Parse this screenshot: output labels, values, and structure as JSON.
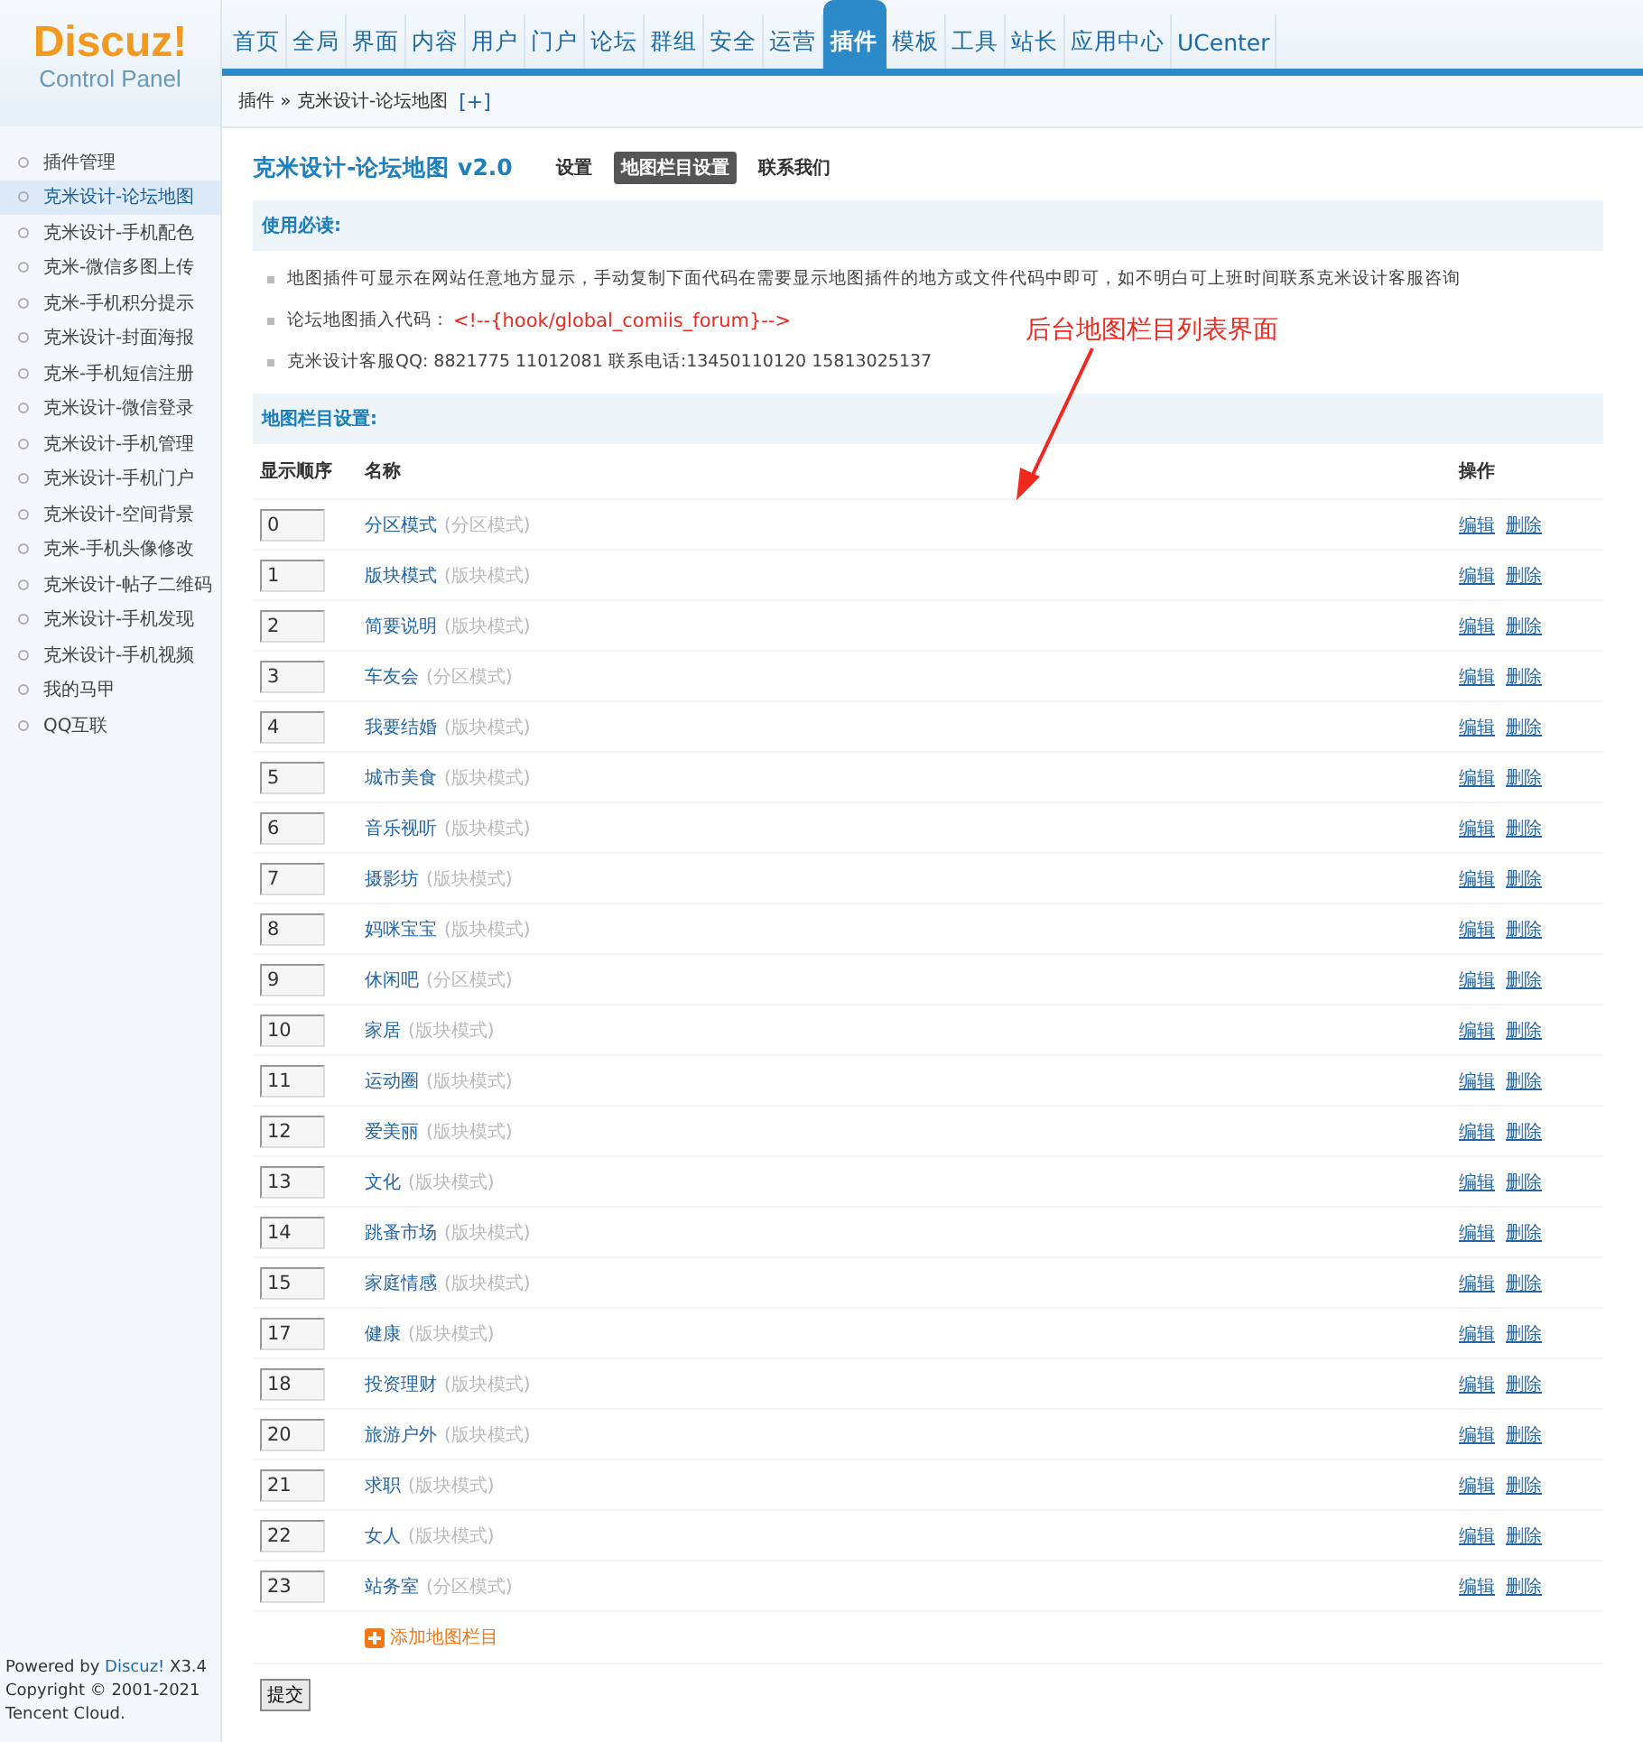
{
  "logo": {
    "brand": "Discuz!",
    "subtitle": "Control Panel"
  },
  "nav": [
    {
      "label": "首页",
      "selected": false
    },
    {
      "label": "全局",
      "selected": false
    },
    {
      "label": "界面",
      "selected": false
    },
    {
      "label": "内容",
      "selected": false
    },
    {
      "label": "用户",
      "selected": false
    },
    {
      "label": "门户",
      "selected": false
    },
    {
      "label": "论坛",
      "selected": false
    },
    {
      "label": "群组",
      "selected": false
    },
    {
      "label": "安全",
      "selected": false
    },
    {
      "label": "运营",
      "selected": false
    },
    {
      "label": "插件",
      "selected": true
    },
    {
      "label": "模板",
      "selected": false
    },
    {
      "label": "工具",
      "selected": false
    },
    {
      "label": "站长",
      "selected": false
    },
    {
      "label": "应用中心",
      "selected": false
    },
    {
      "label": "UCenter",
      "selected": false
    }
  ],
  "breadcrumb": {
    "path": "插件 » 克米设计-论坛地图",
    "add": "[+]"
  },
  "sidebar": {
    "items": [
      {
        "label": "插件管理",
        "selected": false
      },
      {
        "label": "克米设计-论坛地图",
        "selected": true
      },
      {
        "label": "克米设计-手机配色",
        "selected": false
      },
      {
        "label": "克米-微信多图上传",
        "selected": false
      },
      {
        "label": "克米-手机积分提示",
        "selected": false
      },
      {
        "label": "克米设计-封面海报",
        "selected": false
      },
      {
        "label": "克米-手机短信注册",
        "selected": false
      },
      {
        "label": "克米设计-微信登录",
        "selected": false
      },
      {
        "label": "克米设计-手机管理",
        "selected": false
      },
      {
        "label": "克米设计-手机门户",
        "selected": false
      },
      {
        "label": "克米设计-空间背景",
        "selected": false
      },
      {
        "label": "克米-手机头像修改",
        "selected": false
      },
      {
        "label": "克米设计-帖子二维码",
        "selected": false
      },
      {
        "label": "克米设计-手机发现",
        "selected": false
      },
      {
        "label": "克米设计-手机视频",
        "selected": false
      },
      {
        "label": "我的马甲",
        "selected": false
      },
      {
        "label": "QQ互联",
        "selected": false
      }
    ],
    "footer": {
      "powered": "Powered by",
      "link": "Discuz!",
      "version": "X3.4",
      "copyright": "Copyright © 2001-2021",
      "company": "Tencent Cloud."
    }
  },
  "page": {
    "title": "克米设计-论坛地图 v2.0",
    "tabs": [
      {
        "label": "设置",
        "selected": false
      },
      {
        "label": "地图栏目设置",
        "selected": true
      },
      {
        "label": "联系我们",
        "selected": false
      }
    ]
  },
  "notice": {
    "heading": "使用必读:",
    "items": [
      {
        "text": "地图插件可显示在网站任意地方显示，手动复制下面代码在需要显示地图插件的地方或文件代码中即可，如不明白可上班时间联系克米设计客服咨询"
      },
      {
        "text": "论坛地图插入代码：",
        "code": "<!--{hook/global_comiis_forum}-->"
      },
      {
        "text": "克米设计客服QQ: 8821775 11012081   联系电话:13450110120 15813025137"
      }
    ]
  },
  "annotation": "后台地图栏目列表界面",
  "table": {
    "heading": "地图栏目设置:",
    "columns": [
      "显示顺序",
      "名称",
      "操作"
    ],
    "rows": [
      {
        "order": "0",
        "name": "分区模式",
        "mode": "(分区模式)",
        "edit": "编辑",
        "delete": "删除"
      },
      {
        "order": "1",
        "name": "版块模式",
        "mode": "(版块模式)",
        "edit": "编辑",
        "delete": "删除"
      },
      {
        "order": "2",
        "name": "简要说明",
        "mode": "(版块模式)",
        "edit": "编辑",
        "delete": "删除"
      },
      {
        "order": "3",
        "name": "车友会",
        "mode": "(分区模式)",
        "edit": "编辑",
        "delete": "删除"
      },
      {
        "order": "4",
        "name": "我要结婚",
        "mode": "(版块模式)",
        "edit": "编辑",
        "delete": "删除"
      },
      {
        "order": "5",
        "name": "城市美食",
        "mode": "(版块模式)",
        "edit": "编辑",
        "delete": "删除"
      },
      {
        "order": "6",
        "name": "音乐视听",
        "mode": "(版块模式)",
        "edit": "编辑",
        "delete": "删除"
      },
      {
        "order": "7",
        "name": "摄影坊",
        "mode": "(版块模式)",
        "edit": "编辑",
        "delete": "删除"
      },
      {
        "order": "8",
        "name": "妈咪宝宝",
        "mode": "(版块模式)",
        "edit": "编辑",
        "delete": "删除"
      },
      {
        "order": "9",
        "name": "休闲吧",
        "mode": "(分区模式)",
        "edit": "编辑",
        "delete": "删除"
      },
      {
        "order": "10",
        "name": "家居",
        "mode": "(版块模式)",
        "edit": "编辑",
        "delete": "删除"
      },
      {
        "order": "11",
        "name": "运动圈",
        "mode": "(版块模式)",
        "edit": "编辑",
        "delete": "删除"
      },
      {
        "order": "12",
        "name": "爱美丽",
        "mode": "(版块模式)",
        "edit": "编辑",
        "delete": "删除"
      },
      {
        "order": "13",
        "name": "文化",
        "mode": "(版块模式)",
        "edit": "编辑",
        "delete": "删除"
      },
      {
        "order": "14",
        "name": "跳蚤市场",
        "mode": "(版块模式)",
        "edit": "编辑",
        "delete": "删除"
      },
      {
        "order": "15",
        "name": "家庭情感",
        "mode": "(版块模式)",
        "edit": "编辑",
        "delete": "删除"
      },
      {
        "order": "17",
        "name": "健康",
        "mode": "(版块模式)",
        "edit": "编辑",
        "delete": "删除"
      },
      {
        "order": "18",
        "name": "投资理财",
        "mode": "(版块模式)",
        "edit": "编辑",
        "delete": "删除"
      },
      {
        "order": "20",
        "name": "旅游户外",
        "mode": "(版块模式)",
        "edit": "编辑",
        "delete": "删除"
      },
      {
        "order": "21",
        "name": "求职",
        "mode": "(版块模式)",
        "edit": "编辑",
        "delete": "删除"
      },
      {
        "order": "22",
        "name": "女人",
        "mode": "(版块模式)",
        "edit": "编辑",
        "delete": "删除"
      },
      {
        "order": "23",
        "name": "站务室",
        "mode": "(分区模式)",
        "edit": "编辑",
        "delete": "删除"
      }
    ],
    "add": "添加地图栏目"
  },
  "submit": "提交"
}
